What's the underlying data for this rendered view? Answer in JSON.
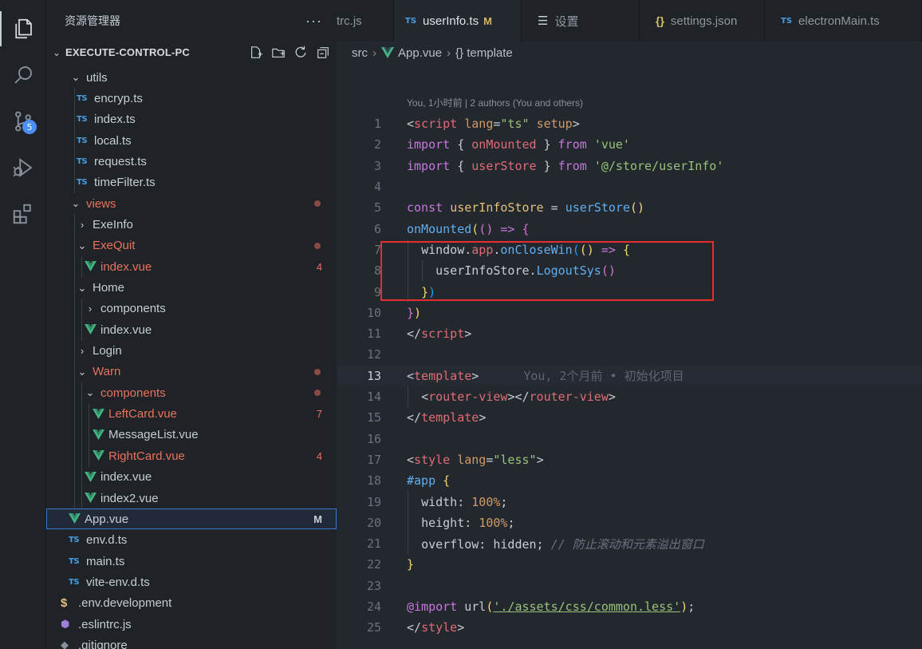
{
  "activity_bar": {
    "items": [
      {
        "name": "explorer-icon",
        "active": true
      },
      {
        "name": "search-icon"
      },
      {
        "name": "source-control-icon",
        "badge": "5"
      },
      {
        "name": "run-debug-icon"
      },
      {
        "name": "extensions-icon"
      }
    ]
  },
  "sidebar": {
    "title": "资源管理器",
    "more": "···",
    "project": "EXECUTE-CONTROL-PC"
  },
  "tree": [
    {
      "label": "utils",
      "type": "folder-open",
      "depth": 0
    },
    {
      "label": "encryp.ts",
      "type": "ts",
      "depth": 1
    },
    {
      "label": "index.ts",
      "type": "ts",
      "depth": 1
    },
    {
      "label": "local.ts",
      "type": "ts",
      "depth": 1
    },
    {
      "label": "request.ts",
      "type": "ts",
      "depth": 1
    },
    {
      "label": "timeFilter.ts",
      "type": "ts",
      "depth": 1
    },
    {
      "label": "views",
      "type": "folder-open",
      "depth": 0,
      "modified": true,
      "dot": true
    },
    {
      "label": "ExeInfo",
      "type": "folder",
      "depth": 1
    },
    {
      "label": "ExeQuit",
      "type": "folder-open",
      "depth": 1,
      "modified": true,
      "dot": true
    },
    {
      "label": "index.vue",
      "type": "vue",
      "depth": 2,
      "modified": true,
      "count": "4"
    },
    {
      "label": "Home",
      "type": "folder-open",
      "depth": 1
    },
    {
      "label": "components",
      "type": "folder",
      "depth": 2
    },
    {
      "label": "index.vue",
      "type": "vue",
      "depth": 2
    },
    {
      "label": "Login",
      "type": "folder",
      "depth": 1
    },
    {
      "label": "Warn",
      "type": "folder-open",
      "depth": 1,
      "modified": true,
      "dot": true
    },
    {
      "label": "components",
      "type": "folder-open",
      "depth": 2,
      "modified": true,
      "dot": true
    },
    {
      "label": "LeftCard.vue",
      "type": "vue",
      "depth": 3,
      "modified": true,
      "count": "7"
    },
    {
      "label": "MessageList.vue",
      "type": "vue",
      "depth": 3
    },
    {
      "label": "RightCard.vue",
      "type": "vue",
      "depth": 3,
      "modified": true,
      "count": "4"
    },
    {
      "label": "index.vue",
      "type": "vue",
      "depth": 2
    },
    {
      "label": "index2.vue",
      "type": "vue",
      "depth": 2
    },
    {
      "label": "App.vue",
      "type": "vue",
      "depth": -1,
      "selected": true,
      "count": "M"
    },
    {
      "label": "env.d.ts",
      "type": "ts",
      "depth": -1
    },
    {
      "label": "main.ts",
      "type": "ts",
      "depth": -1
    },
    {
      "label": "vite-env.d.ts",
      "type": "ts",
      "depth": -1
    },
    {
      "label": ".env.development",
      "type": "env",
      "depth": -2
    },
    {
      "label": ".eslintrc.js",
      "type": "eslint",
      "depth": -2
    },
    {
      "label": ".gitignore",
      "type": "git",
      "depth": -2
    }
  ],
  "tabs": [
    {
      "label": "trc.js",
      "icon": ""
    },
    {
      "label": "userInfo.ts",
      "icon": "TS",
      "status": "M",
      "active": true
    },
    {
      "label": "设置",
      "icon": "menu"
    },
    {
      "label": "settings.json",
      "icon": "{}"
    },
    {
      "label": "electronMain.ts",
      "icon": "TS"
    }
  ],
  "breadcrumb": {
    "src": "src",
    "file": "App.vue",
    "symbol": "{} template"
  },
  "code": {
    "blame_header": "You, 1小时前 | 2 authors (You and others)",
    "inline_blame_13": "You, 2个月前 • 初始化项目",
    "current_line": 13,
    "line_numbers": [
      "1",
      "2",
      "3",
      "4",
      "5",
      "6",
      "7",
      "8",
      "9",
      "10",
      "11",
      "12",
      "13",
      "14",
      "15",
      "16",
      "17",
      "18",
      "19",
      "20",
      "21",
      "22",
      "23",
      "24",
      "25"
    ]
  },
  "colors": {
    "modified": "#e8735b",
    "ts_blue": "#4a9ee0",
    "vue_green": "#41b883",
    "highlight_red": "#e52d2d",
    "selection_border": "#3a78c9"
  }
}
